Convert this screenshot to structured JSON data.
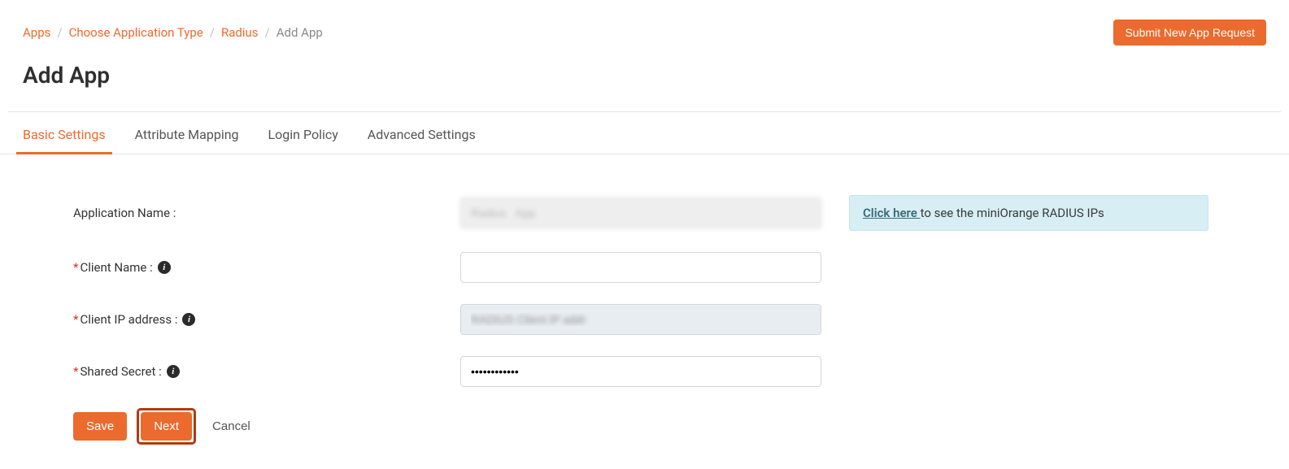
{
  "breadcrumb": {
    "apps": "Apps",
    "choose_type": "Choose Application Type",
    "radius": "Radius",
    "add_app": "Add App"
  },
  "header": {
    "submit_request": "Submit New App Request",
    "page_title": "Add App"
  },
  "tabs": {
    "basic": "Basic Settings",
    "attribute": "Attribute Mapping",
    "login": "Login Policy",
    "advanced": "Advanced Settings"
  },
  "form": {
    "app_name_label": "Application Name :",
    "app_name_value": "Radius   App",
    "client_name_label": "Client Name :",
    "client_name_value": "",
    "client_ip_label": "Client IP address :",
    "client_ip_value": "RADIUS Client IP addr",
    "shared_secret_label": "Shared Secret :",
    "shared_secret_value": "••••••••••••"
  },
  "info_box": {
    "link_text": "Click here ",
    "rest_text": "to see the miniOrange RADIUS IPs"
  },
  "actions": {
    "save": "Save",
    "next": "Next",
    "cancel": "Cancel"
  }
}
